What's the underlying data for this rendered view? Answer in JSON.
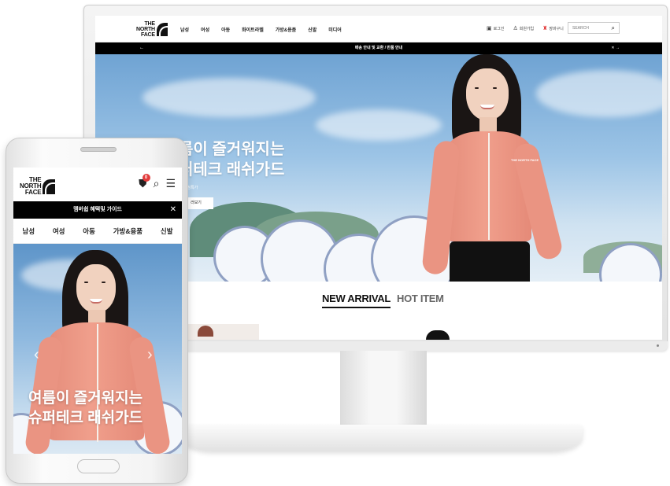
{
  "desktop": {
    "logo": {
      "line1": "THE",
      "line2": "NORTH",
      "line3": "FACE"
    },
    "nav": [
      "남성",
      "여성",
      "아동",
      "화이트라벨",
      "가방&용품",
      "신발",
      "미디어"
    ],
    "utils": [
      {
        "icon": "▣",
        "label": "로그인"
      },
      {
        "icon": "♙",
        "label": "회원가입"
      },
      {
        "icon": "♜",
        "label": "장바구니"
      }
    ],
    "search_placeholder": "SEARCH",
    "search_icon": "⌕",
    "notice": "배송 안내 및 교환 / 반품 안내",
    "notice_prev": "←",
    "notice_next": "✕ →",
    "hero": {
      "title_line1": "름이 즐거워지는",
      "title_line2": "퍼테크 래쉬가드",
      "subtitle": "지 한정특가",
      "button": "러보기",
      "jacket_logo": "THE NORTH FACE"
    },
    "tabs": [
      {
        "label": "NEW ARRIVAL",
        "active": true
      },
      {
        "label": "HOT ITEM",
        "active": false
      }
    ]
  },
  "mobile": {
    "logo": {
      "line1": "THE",
      "line2": "NORTH",
      "line3": "FACE"
    },
    "bag_count": "0",
    "bag_icon": "⛊",
    "search_icon": "⌕",
    "menu_icon": "☰",
    "notice": "멤버쉽 혜택및 가이드",
    "notice_close": "✕",
    "nav": [
      "남성",
      "여성",
      "아동",
      "가방&용품",
      "신발"
    ],
    "hero": {
      "title_line1": "여름이 즐거워지는",
      "title_line2": "슈퍼테크 래쉬가드",
      "prev": "‹",
      "next": "›"
    }
  },
  "colors": {
    "accent_black": "#000000",
    "badge_red": "#e23b3b",
    "rashguard_coral": "#f09f8c",
    "sky_blue": "#7aaedb"
  }
}
